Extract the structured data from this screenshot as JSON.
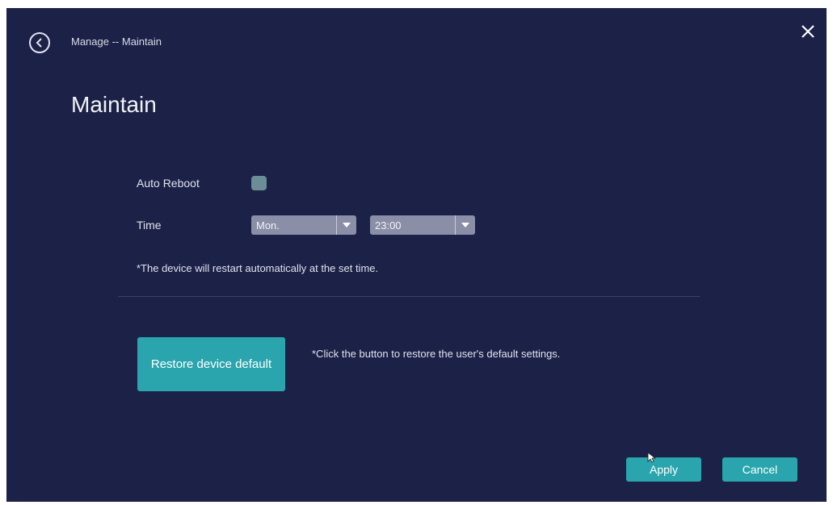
{
  "header": {
    "breadcrumb": "Manage -- Maintain",
    "title": "Maintain",
    "back_icon": "back-circle-icon",
    "close_icon": "close-icon"
  },
  "auto_reboot": {
    "label": "Auto Reboot",
    "checked": true,
    "checkbox_color": "#6b8d95"
  },
  "time": {
    "label": "Time",
    "day_select": {
      "value": "Mon."
    },
    "hour_select": {
      "value": "23:00"
    }
  },
  "notes": {
    "restart": "*The device will restart automatically at the set time.",
    "restore": "*Click the button to restore the user's default settings."
  },
  "restore": {
    "label": "Restore device default"
  },
  "footer": {
    "apply_label": "Apply",
    "cancel_label": "Cancel"
  },
  "colors": {
    "background": "#1b2147",
    "accent": "#2aa5ad",
    "select": "#8a8ea6"
  }
}
